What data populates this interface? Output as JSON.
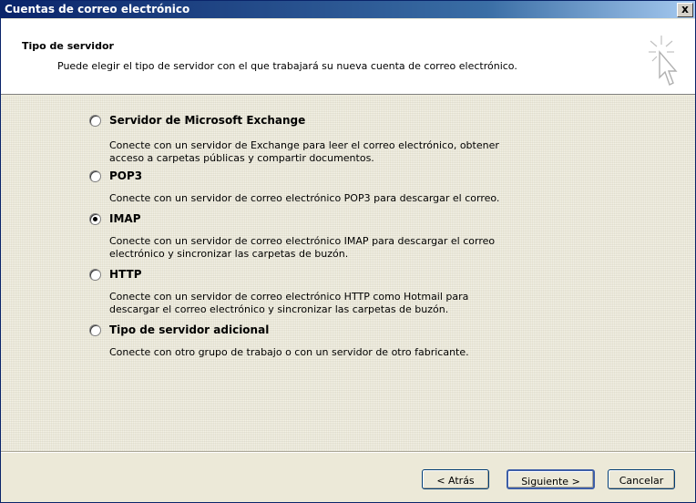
{
  "window": {
    "title": "Cuentas de correo electrónico",
    "close_label": "x"
  },
  "header": {
    "title": "Tipo de servidor",
    "subtitle": "Puede elegir el tipo de servidor con el que trabajará su nueva cuenta de correo electrónico."
  },
  "options": [
    {
      "label": "Servidor de Microsoft Exchange",
      "checked": false,
      "desc_lines": [
        "Conecte con un servidor de Exchange para leer el correo electrónico, obtener",
        "acceso a carpetas públicas y compartir documentos."
      ]
    },
    {
      "label": "POP3",
      "checked": false,
      "desc_lines": [
        "Conecte con un servidor de correo electrónico POP3 para descargar el correo."
      ]
    },
    {
      "label": "IMAP",
      "checked": true,
      "desc_lines": [
        "Conecte con un servidor de correo electrónico IMAP para descargar el correo",
        "electrónico y sincronizar las carpetas de buzón."
      ]
    },
    {
      "label": "HTTP",
      "checked": false,
      "desc_lines": [
        "Conecte con un servidor de correo electrónico HTTP como Hotmail para",
        "descargar el correo electrónico y sincronizar las carpetas de buzón."
      ]
    },
    {
      "label": "Tipo de servidor adicional",
      "checked": false,
      "desc_lines": [
        "Conecte con otro grupo de trabajo o con un servidor de otro fabricante."
      ]
    }
  ],
  "buttons": {
    "back": "< Atrás",
    "next": "Siguiente >",
    "cancel": "Cancelar"
  }
}
